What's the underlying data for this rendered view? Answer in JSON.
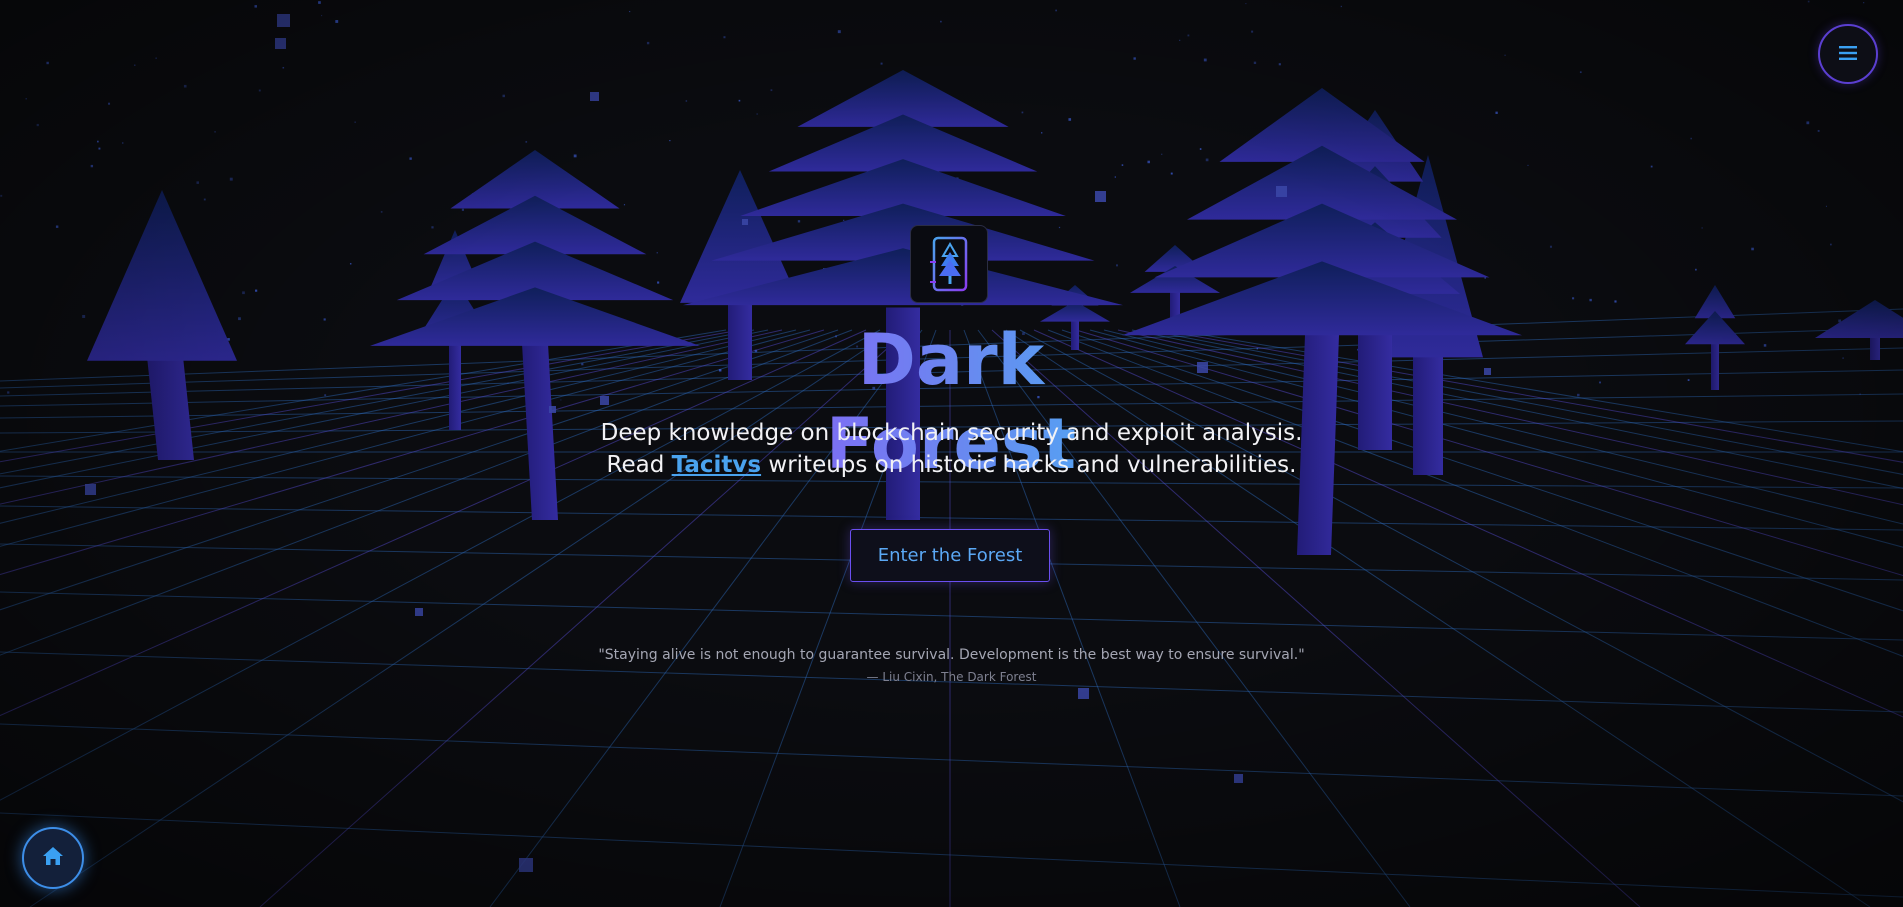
{
  "hero": {
    "title": "Dark Forest",
    "subtitle_line1": "Deep knowledge on blockchain security and exploit analysis.",
    "subtitle_prefix": "Read ",
    "brand_link": "Tacitvs",
    "subtitle_suffix": " writeups on historic hacks and vulnerabilities.",
    "cta_label": "Enter the Forest",
    "quote": "\"Staying alive is not enough to guarantee survival. Development is the best way to ensure survival.\"",
    "quote_author": "— Liu Cixin, The Dark Forest"
  },
  "icons": {
    "menu": "hamburger-icon",
    "home": "home-icon",
    "logo": "forest-card-logo-icon"
  },
  "colors": {
    "background": "#0b0c10",
    "tree": "#2a2390",
    "grid": "#3a7fd8",
    "title_gradient_start": "#8a5cf6",
    "title_gradient_end": "#46b4f4",
    "link": "#4aa3ee",
    "button_border": "#6b4ff0",
    "home_glow": "#3d8ee8"
  }
}
